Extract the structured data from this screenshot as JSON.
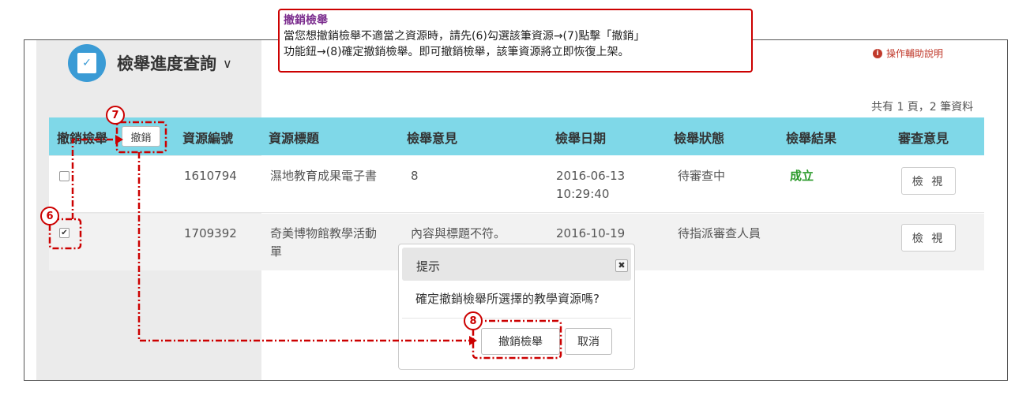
{
  "callout": {
    "title": "撤銷檢舉",
    "line1": "當您想撤銷檢舉不適當之資源時，請先(6)勾選該筆資源→(7)點擊「撤銷」",
    "line2": "功能鈕→(8)確定撤銷檢舉。即可撤銷檢舉，該筆資源將立即恢復上架。"
  },
  "header": {
    "title": "檢舉進度查詢",
    "caret": "∨",
    "help_label": "操作輔助說明",
    "summary": "共有 1 頁，2 筆資料"
  },
  "table": {
    "columns": [
      "撤銷檢舉",
      "資源編號",
      "資源標題",
      "檢舉意見",
      "檢舉日期",
      "檢舉狀態",
      "檢舉結果",
      "審查意見"
    ],
    "revoke_button": "撤銷",
    "rows": [
      {
        "checked": false,
        "id": "1610794",
        "title": "濕地教育成果電子書",
        "opinion": "8",
        "date": "2016-06-13",
        "time": "10:29:40",
        "status": "待審查中",
        "result": "成立",
        "action": "檢 視"
      },
      {
        "checked": true,
        "id": "1709392",
        "title_line1": "奇美博物館教學活動",
        "title_line2": "單",
        "opinion": "內容與標題不符。",
        "date": "2016-10-19",
        "status": "待指派審查人員",
        "result": "",
        "action": "檢 視"
      }
    ]
  },
  "dialog": {
    "title": "提示",
    "close": "✖",
    "message": "確定撤銷檢舉所選擇的教學資源嗎?",
    "confirm": "撤銷檢舉",
    "cancel": "取消"
  },
  "steps": [
    "6",
    "7",
    "8"
  ],
  "colors": {
    "header_bg": "#7fd8e8",
    "annotation": "#cc0000",
    "accent_icon": "#3a9bd5",
    "success": "#2a9a2a",
    "callout_title": "#7b2d8e"
  }
}
